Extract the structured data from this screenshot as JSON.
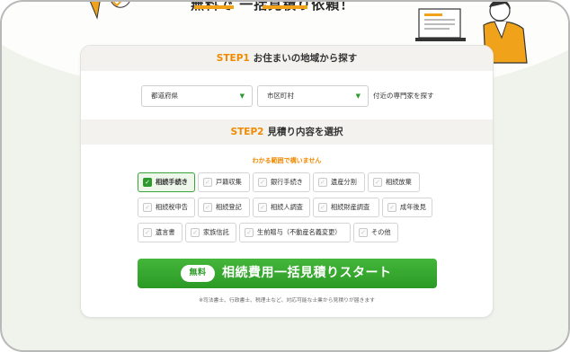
{
  "hero": {
    "title_partial": "無料で 一括見積り依頼！"
  },
  "step1": {
    "num": "STEP1",
    "title": "お住まいの地域から探す",
    "prefecture_select": "都道府県",
    "city_select": "市区町村",
    "near_text": "付近の専門家を探す"
  },
  "step2": {
    "num": "STEP2",
    "title": "見積り内容を選択",
    "hint": "わかる範囲で構いません",
    "options": [
      {
        "label": "相続手続き",
        "checked": true
      },
      {
        "label": "戸籍収集",
        "checked": false
      },
      {
        "label": "銀行手続き",
        "checked": false
      },
      {
        "label": "遺産分割",
        "checked": false
      },
      {
        "label": "相続放棄",
        "checked": false
      },
      {
        "label": "相続税申告",
        "checked": false
      },
      {
        "label": "相続登記",
        "checked": false
      },
      {
        "label": "相続人調査",
        "checked": false
      },
      {
        "label": "相続財産調査",
        "checked": false
      },
      {
        "label": "成年後見",
        "checked": false
      },
      {
        "label": "遺言書",
        "checked": false
      },
      {
        "label": "家族信託",
        "checked": false
      },
      {
        "label": "生前贈与（不動産名義変更）",
        "checked": false
      },
      {
        "label": "その他",
        "checked": false
      }
    ]
  },
  "cta": {
    "badge": "無料",
    "label": "相続費用一括見積りスタート"
  },
  "note": "※司法書士、行政書士、税理士など、対応可能な士業から見積りが届きます",
  "colors": {
    "accent_orange": "#f08a00",
    "primary_green": "#2e9a2e"
  },
  "icons": {
    "select_arrow": "triangle-down-icon",
    "checkbox": "check-icon"
  }
}
